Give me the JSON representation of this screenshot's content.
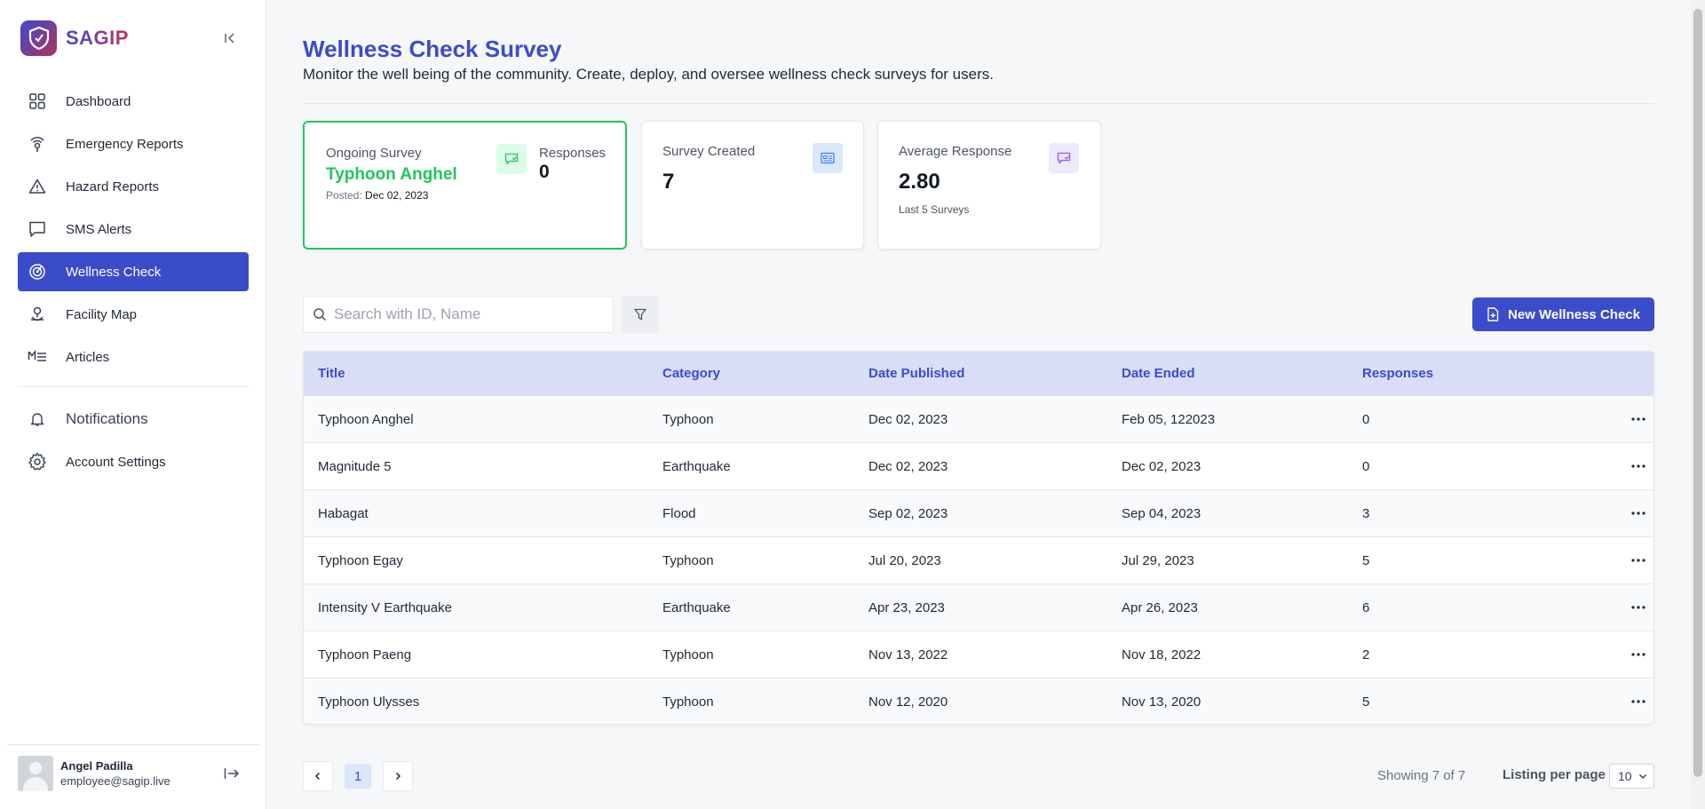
{
  "brand": {
    "name": "SAGIP"
  },
  "nav": [
    {
      "label": "Dashboard",
      "icon": "grid-icon"
    },
    {
      "label": "Emergency Reports",
      "icon": "broadcast-icon"
    },
    {
      "label": "Hazard Reports",
      "icon": "warning-icon"
    },
    {
      "label": "SMS Alerts",
      "icon": "message-icon"
    },
    {
      "label": "Wellness Check",
      "icon": "radar-icon",
      "active": true
    },
    {
      "label": "Facility Map",
      "icon": "map-pin-icon"
    },
    {
      "label": "Articles",
      "icon": "markdown-icon"
    }
  ],
  "nav2": [
    {
      "label": "Notifications",
      "icon": "bell-icon"
    },
    {
      "label": "Account Settings",
      "icon": "gear-icon"
    }
  ],
  "user": {
    "name": "Angel Padilla",
    "email": "employee@sagip.live"
  },
  "header": {
    "title": "Wellness Check Survey",
    "subtitle": "Monitor the well being of the community. Create, deploy, and oversee wellness check surveys for users."
  },
  "cards": {
    "ongoing": {
      "label": "Ongoing Survey",
      "name": "Typhoon Anghel",
      "posted_prefix": "Posted:",
      "posted_date": "Dec 02, 2023",
      "responses_label": "Responses",
      "responses": "0"
    },
    "created": {
      "label": "Survey Created",
      "value": "7"
    },
    "average": {
      "label": "Average Response",
      "value": "2.80",
      "note": "Last 5 Surveys"
    }
  },
  "search": {
    "placeholder": "Search with ID, Name"
  },
  "new_button": {
    "label": "New Wellness Check"
  },
  "table": {
    "headers": {
      "title": "Title",
      "category": "Category",
      "published": "Date Published",
      "ended": "Date Ended",
      "responses": "Responses"
    },
    "rows": [
      {
        "title": "Typhoon Anghel",
        "category": "Typhoon",
        "published": "Dec 02, 2023",
        "ended": "Feb 05, 122023",
        "responses": "0"
      },
      {
        "title": "Magnitude 5",
        "category": "Earthquake",
        "published": "Dec 02, 2023",
        "ended": "Dec 02, 2023",
        "responses": "0"
      },
      {
        "title": "Habagat",
        "category": "Flood",
        "published": "Sep 02, 2023",
        "ended": "Sep 04, 2023",
        "responses": "3"
      },
      {
        "title": "Typhoon Egay",
        "category": "Typhoon",
        "published": "Jul 20, 2023",
        "ended": "Jul 29, 2023",
        "responses": "5"
      },
      {
        "title": "Intensity V Earthquake",
        "category": "Earthquake",
        "published": "Apr 23, 2023",
        "ended": "Apr 26, 2023",
        "responses": "6"
      },
      {
        "title": "Typhoon Paeng",
        "category": "Typhoon",
        "published": "Nov 13, 2022",
        "ended": "Nov 18, 2022",
        "responses": "2"
      },
      {
        "title": "Typhoon Ulysses",
        "category": "Typhoon",
        "published": "Nov 12, 2020",
        "ended": "Nov 13, 2020",
        "responses": "5"
      }
    ]
  },
  "pagination": {
    "current_page": "1",
    "showing": "Showing 7 of 7",
    "per_page_label": "Listing per page",
    "per_page_value": "10"
  },
  "colors": {
    "primary": "#3b4cca",
    "ongoing_border": "#22c55e",
    "header_bg": "#d9ddf5"
  }
}
